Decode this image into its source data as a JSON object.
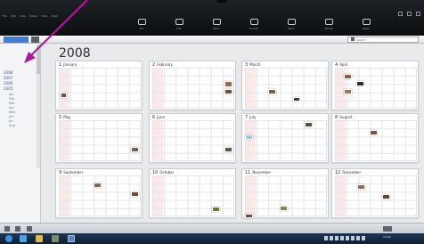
{
  "app": {
    "menus": [
      "File",
      "Edit",
      "View",
      "Folder",
      "Tools",
      "Help"
    ],
    "toolbar": [
      {
        "label": "Fix",
        "icon": "wrench-icon"
      },
      {
        "label": "Info",
        "icon": "info-icon"
      },
      {
        "label": "Print",
        "icon": "printer-icon"
      },
      {
        "label": "E-mail",
        "icon": "mail-icon"
      },
      {
        "label": "Burn",
        "icon": "disc-icon"
      },
      {
        "label": "Movie",
        "icon": "film-icon"
      },
      {
        "label": "Open",
        "icon": "folder-icon"
      }
    ]
  },
  "filter": {
    "view_label": "",
    "search_placeholder": "Search"
  },
  "sidebar": {
    "items": [
      "2008",
      "2007",
      "2006",
      "2005"
    ],
    "sub_items": [
      "Jan",
      "Feb",
      "Mar",
      "Apr",
      "May",
      "Jun",
      "Jul",
      "Aug"
    ]
  },
  "calendar": {
    "year": "2008",
    "months": [
      {
        "num": "1",
        "name": "January"
      },
      {
        "num": "2",
        "name": "February"
      },
      {
        "num": "3",
        "name": "March"
      },
      {
        "num": "4",
        "name": "April"
      },
      {
        "num": "5",
        "name": "May"
      },
      {
        "num": "6",
        "name": "June"
      },
      {
        "num": "7",
        "name": "July"
      },
      {
        "num": "8",
        "name": "August"
      },
      {
        "num": "9",
        "name": "September"
      },
      {
        "num": "10",
        "name": "October"
      },
      {
        "num": "11",
        "name": "November"
      },
      {
        "num": "12",
        "name": "December"
      }
    ]
  },
  "taskbar": {
    "clock": "12:00"
  },
  "colors": {
    "accent": "#3d7fd6",
    "annotation": "#b0179b"
  }
}
